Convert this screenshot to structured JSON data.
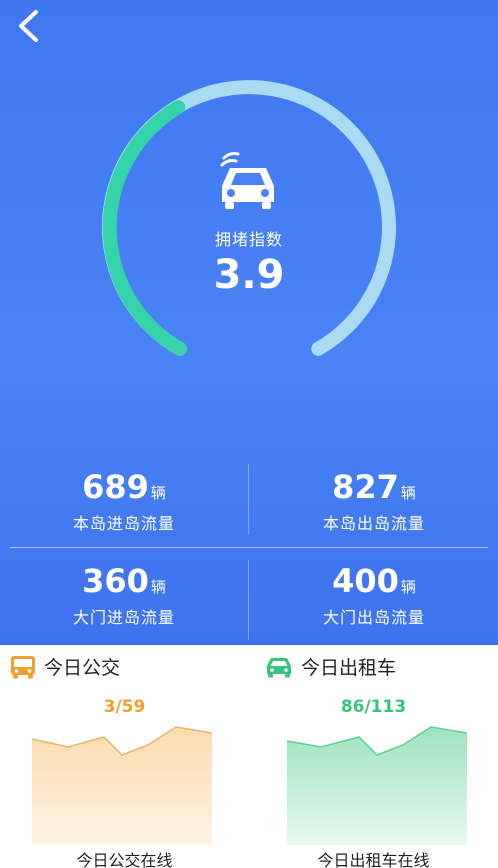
{
  "nav": {
    "back_icon": "back-chevron-icon"
  },
  "gauge": {
    "label": "拥堵指数",
    "value": "3.9",
    "icon": "car-icon",
    "colors": {
      "track": "#a9dcf2",
      "progress": "#34d3a8"
    }
  },
  "stats": [
    {
      "value": "689",
      "unit": "辆",
      "label": "本岛进岛流量"
    },
    {
      "value": "827",
      "unit": "辆",
      "label": "本岛出岛流量"
    },
    {
      "value": "360",
      "unit": "辆",
      "label": "大门进岛流量"
    },
    {
      "value": "400",
      "unit": "辆",
      "label": "大门出岛流量"
    }
  ],
  "bus": {
    "title": "今日公交",
    "count": "3/59",
    "caption": "今日公交在线",
    "icon": "bus-icon",
    "color": "#f0a02c",
    "fill": "#fbe6c6"
  },
  "taxi": {
    "title": "今日出租车",
    "count": "86/113",
    "caption": "今日出租车在线",
    "icon": "taxi-icon",
    "color": "#38c47e",
    "fill": "#bdebd2"
  }
}
